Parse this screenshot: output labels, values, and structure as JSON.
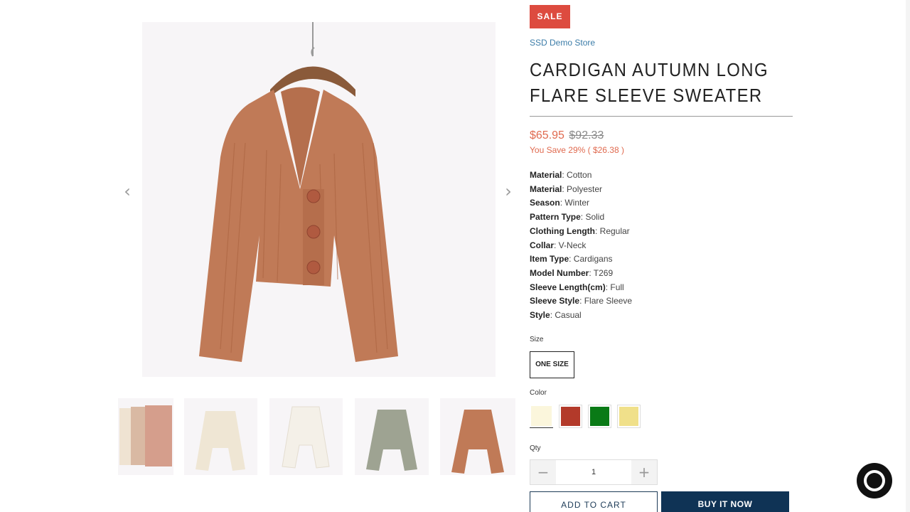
{
  "badge": "SALE",
  "vendor": "SSD Demo Store",
  "product": {
    "title": "CARDIGAN AUTUMN LONG FLARE SLEEVE SWEATER",
    "price_now": "$65.95",
    "price_was": "$92.33",
    "savings": "You Save 29% ( $26.38 )",
    "main_image_color": "#c07a57"
  },
  "specs": [
    {
      "key": "Material",
      "value": ": Cotton"
    },
    {
      "key": "Material",
      "value": ": Polyester"
    },
    {
      "key": "Season",
      "value": ": Winter"
    },
    {
      "key": "Pattern Type",
      "value": ": Solid"
    },
    {
      "key": "Clothing Length",
      "value": ": Regular"
    },
    {
      "key": "Collar",
      "value": ": V-Neck"
    },
    {
      "key": "Item Type",
      "value": ": Cardigans"
    },
    {
      "key": "Model Number",
      "value": ": T269"
    },
    {
      "key": "Sleeve Length(cm)",
      "value": ": Full"
    },
    {
      "key": "Sleeve Style",
      "value": ": Flare Sleeve"
    },
    {
      "key": "Style",
      "value": ": Casual"
    }
  ],
  "size": {
    "label": "Size",
    "selected": "ONE SIZE"
  },
  "color": {
    "label": "Color",
    "swatches": [
      "#fbf6dc",
      "#b33a2a",
      "#0a7a16",
      "#f0e08a"
    ]
  },
  "qty": {
    "label": "Qty",
    "value": "1",
    "minus": "−",
    "plus": "+"
  },
  "buttons": {
    "add_to_cart": "ADD TO CART",
    "buy_now": "BUY IT NOW"
  },
  "gallery": {
    "prev": "‹",
    "next": "›",
    "thumb_colors": [
      "#d8a090",
      "#efe6d4",
      "#f6f3ec",
      "#9ea392",
      "#c07a57"
    ]
  }
}
